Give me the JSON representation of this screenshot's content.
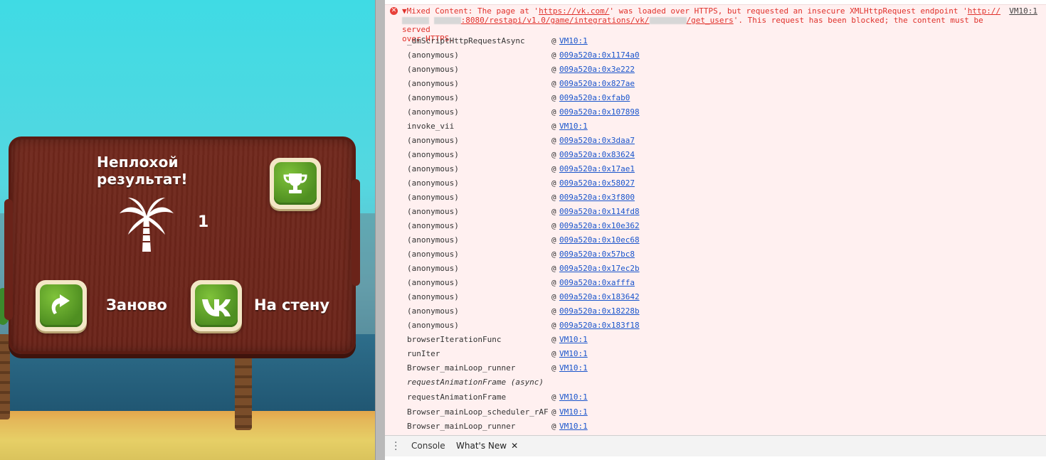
{
  "game": {
    "title": "Неплохой результат!",
    "score": "1",
    "restart_label": "Заново",
    "share_label": "На стену",
    "icons": {
      "trophy": "trophy-icon",
      "restart": "restart-arrow-icon",
      "vk": "vk-logo-icon",
      "palm": "palm-tree-icon"
    },
    "colors": {
      "sign": "#6a2319",
      "button_green": "#5a9e2a",
      "button_frame": "#f3e7c6"
    }
  },
  "console": {
    "error": {
      "prefix": "Mixed Content: The page at '",
      "page_url": "https://vk.com/",
      "middle": "' was loaded over HTTPS, but requested an insecure XMLHttpRequest endpoint '",
      "endpoint_start": "http://",
      "endpoint_path": ":8080/restapi/v1.0/game/integrations/vk/",
      "endpoint_end": "/get_users",
      "suffix": "'. This request has been blocked; the content must be served",
      "suffix2": "over HTTPS.",
      "source": "VM10:1"
    },
    "frames": [
      {
        "fn": "_dmScriptHttpRequestAsync",
        "loc": "VM10:1"
      },
      {
        "fn": "(anonymous)",
        "loc": "009a520a:0x1174a0"
      },
      {
        "fn": "(anonymous)",
        "loc": "009a520a:0x3e222"
      },
      {
        "fn": "(anonymous)",
        "loc": "009a520a:0x827ae"
      },
      {
        "fn": "(anonymous)",
        "loc": "009a520a:0xfab0"
      },
      {
        "fn": "(anonymous)",
        "loc": "009a520a:0x107898"
      },
      {
        "fn": "invoke_vii",
        "loc": "VM10:1"
      },
      {
        "fn": "(anonymous)",
        "loc": "009a520a:0x3daa7"
      },
      {
        "fn": "(anonymous)",
        "loc": "009a520a:0x83624"
      },
      {
        "fn": "(anonymous)",
        "loc": "009a520a:0x17ae1"
      },
      {
        "fn": "(anonymous)",
        "loc": "009a520a:0x58027"
      },
      {
        "fn": "(anonymous)",
        "loc": "009a520a:0x3f800"
      },
      {
        "fn": "(anonymous)",
        "loc": "009a520a:0x114fd8"
      },
      {
        "fn": "(anonymous)",
        "loc": "009a520a:0x10e362"
      },
      {
        "fn": "(anonymous)",
        "loc": "009a520a:0x10ec68"
      },
      {
        "fn": "(anonymous)",
        "loc": "009a520a:0x57bc8"
      },
      {
        "fn": "(anonymous)",
        "loc": "009a520a:0x17ec2b"
      },
      {
        "fn": "(anonymous)",
        "loc": "009a520a:0xafffa"
      },
      {
        "fn": "(anonymous)",
        "loc": "009a520a:0x183642"
      },
      {
        "fn": "(anonymous)",
        "loc": "009a520a:0x18228b"
      },
      {
        "fn": "(anonymous)",
        "loc": "009a520a:0x183f18"
      },
      {
        "fn": "browserIterationFunc",
        "loc": "VM10:1"
      },
      {
        "fn": "runIter",
        "loc": "VM10:1"
      },
      {
        "fn": "Browser_mainLoop_runner",
        "loc": "VM10:1"
      },
      {
        "fn": "requestAnimationFrame (async)",
        "loc": "",
        "async": true
      },
      {
        "fn": "requestAnimationFrame",
        "loc": "VM10:1"
      },
      {
        "fn": "Browser_mainLoop_scheduler_rAF",
        "loc": "VM10:1"
      },
      {
        "fn": "Browser_mainLoop_runner",
        "loc": "VM10:1"
      }
    ],
    "at_sign": "@"
  },
  "drawer": {
    "tabs": [
      {
        "label": "Console",
        "active": false
      },
      {
        "label": "What's New",
        "active": true,
        "closable": true
      }
    ],
    "close_glyph": "✕"
  }
}
